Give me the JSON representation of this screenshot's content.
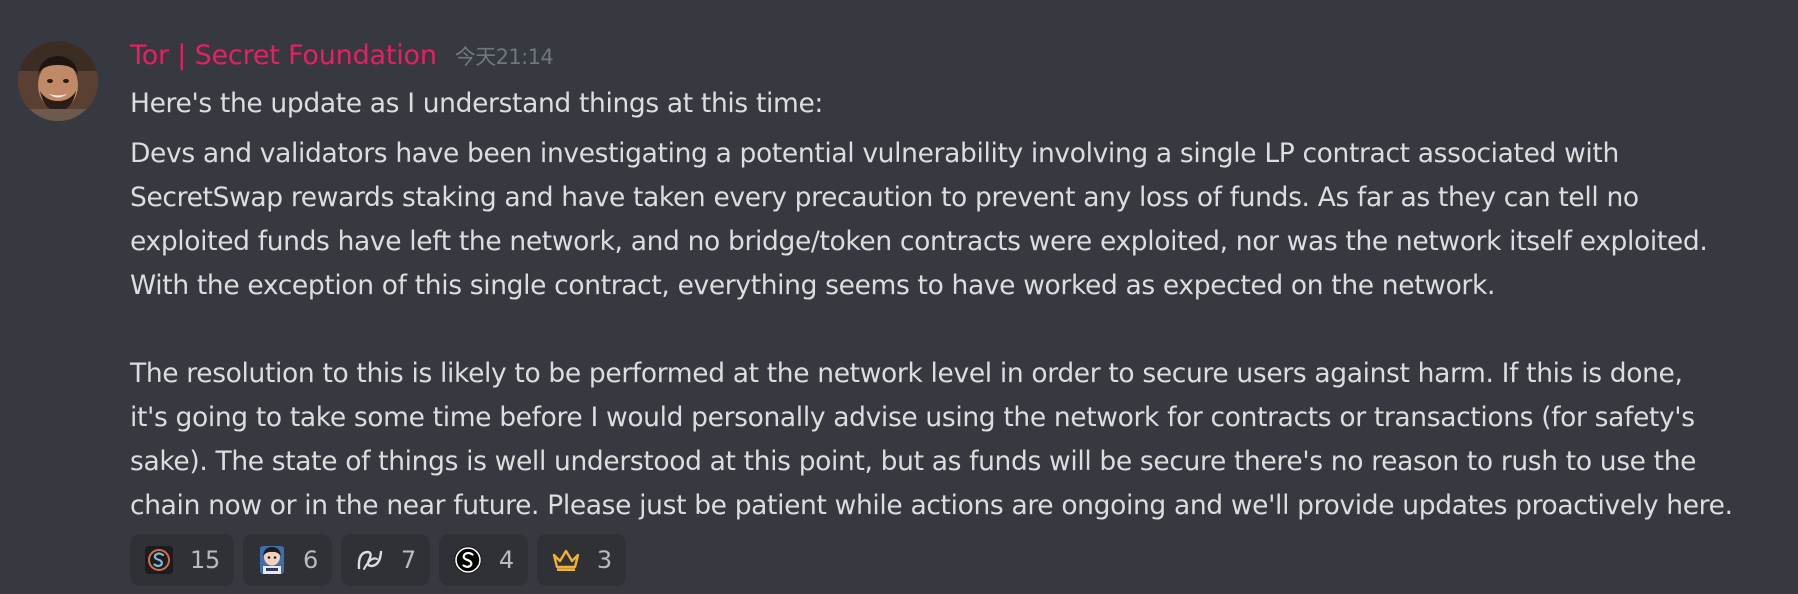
{
  "message": {
    "author": "Tor | Secret Foundation",
    "timestamp": "今天21:14",
    "author_color": "#e91e63",
    "intro": "Here's the update as I understand things at this time:",
    "para1_lines": [
      "Devs and validators have been investigating a potential vulnerability involving a single LP contract associated with",
      "SecretSwap rewards staking and have taken every precaution to prevent any loss of funds. As far as they can tell no",
      "exploited funds have left the network, and no bridge/token contracts were exploited, nor was the network itself exploited.",
      "With the exception of this single contract, everything seems to have worked as expected on the network."
    ],
    "para2_lines": [
      "The resolution to this is likely to be performed at the network level in order to secure users against harm. If this is done,",
      "it's going to take some time before I would personally advise using the network for contracts or transactions (for safety's",
      "sake). The state of things is well understood at this point, but as funds will be secure there's no reason to rush to use the",
      "chain now or in the near future. Please just be patient while actions are ongoing and we'll provide updates proactively here."
    ]
  },
  "reactions": [
    {
      "icon": "secret-logo-dark-icon",
      "count": "15"
    },
    {
      "icon": "anime-avatar-icon",
      "count": "6"
    },
    {
      "icon": "secret-swirl-icon",
      "count": "7"
    },
    {
      "icon": "secret-logo-circle-icon",
      "count": "4"
    },
    {
      "icon": "crown-icon",
      "count": "3"
    }
  ],
  "colors": {
    "background": "#36393f",
    "text": "#dcddde",
    "timestamp": "#72767d",
    "reaction_bg": "#2f3136",
    "crown": "#f0b232"
  }
}
